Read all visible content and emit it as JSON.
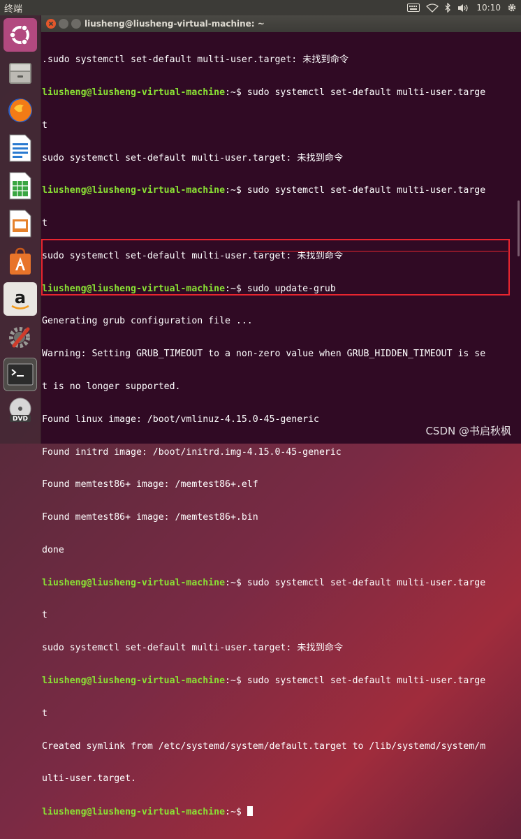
{
  "top_panel": {
    "app_name": "终端",
    "time": "10:10"
  },
  "launcher": {
    "items": [
      "ubuntu-logo",
      "files",
      "firefox",
      "libreoffice-writer",
      "libreoffice-calc",
      "libreoffice-impress",
      "software-center",
      "amazon",
      "system-settings",
      "terminal",
      "dvd"
    ]
  },
  "window": {
    "title": "liusheng@liusheng-virtual-machine: ~"
  },
  "terminal": {
    "prompt": "liusheng@liusheng-virtual-machine",
    "prompt_suffix": ":~$ ",
    "lines": [
      ".sudo systemctl set-default multi-user.target: 未找到命令",
      "sudo systemctl set-default multi-user.targe",
      "t",
      "sudo systemctl set-default multi-user.target: 未找到命令",
      "sudo systemctl set-default multi-user.targe",
      "t",
      "sudo systemctl set-default multi-user.target: 未找到命令",
      "sudo update-grub",
      "Generating grub configuration file ...",
      "Warning: Setting GRUB_TIMEOUT to a non-zero value when GRUB_HIDDEN_TIMEOUT is se",
      "t is no longer supported.",
      "Found linux image: /boot/vmlinuz-4.15.0-45-generic",
      "Found initrd image: /boot/initrd.img-4.15.0-45-generic",
      "Found memtest86+ image: /memtest86+.elf",
      "Found memtest86+ image: /memtest86+.bin",
      "done",
      "sudo systemctl set-default multi-user.targe",
      "t",
      "sudo systemctl set-default multi-user.target: 未找到命令",
      "sudo systemctl set-default multi-user.targe",
      "t",
      "Created symlink from /etc/systemd/system/default.target to /lib/systemd/system/m",
      "ulti-user.target.",
      ""
    ]
  },
  "watermark": "CSDN @书启秋枫"
}
